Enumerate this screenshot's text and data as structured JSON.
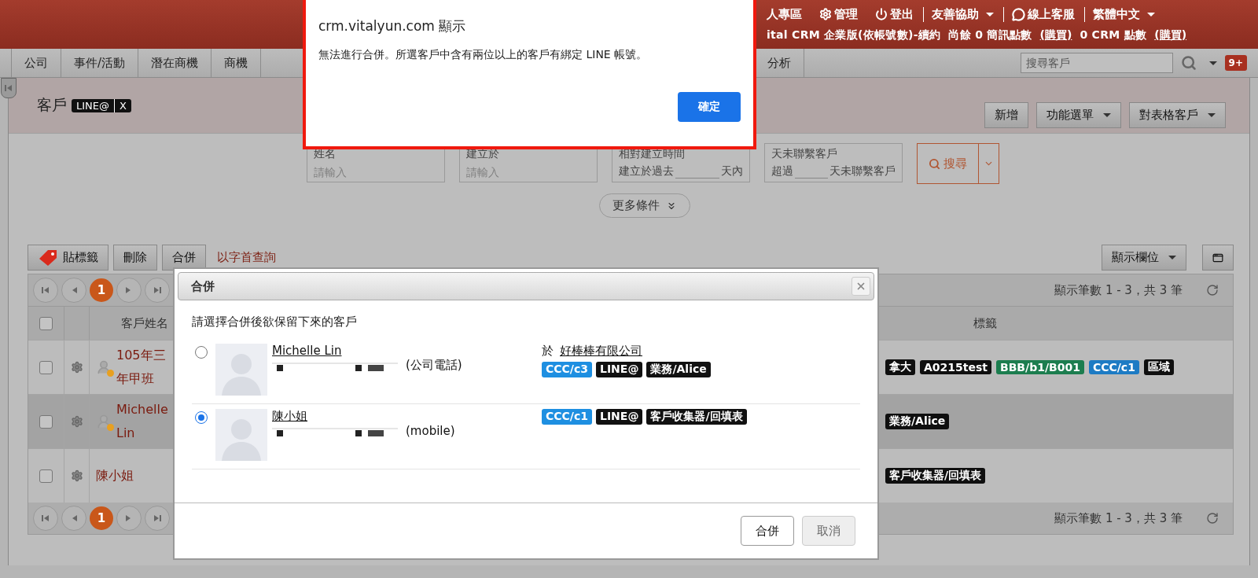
{
  "header": {
    "account_links": [
      {
        "kind": "person",
        "label": "人專區"
      },
      {
        "kind": "gear",
        "label": "管理"
      },
      {
        "kind": "power",
        "label": "登出"
      },
      {
        "kind": "dropdown",
        "label": "友善協助"
      },
      {
        "kind": "chat",
        "label": "線上客服"
      },
      {
        "kind": "dropdown",
        "label": "繁體中文"
      }
    ],
    "info_line": [
      {
        "kind": "text",
        "text": "ital CRM 企業版(依帳號數)-續約"
      },
      {
        "kind": "text",
        "text": "尚餘 0 簡訊點數"
      },
      {
        "kind": "link",
        "text": "(購買)"
      },
      {
        "kind": "text",
        "text": "0 CRM 點數"
      },
      {
        "kind": "link",
        "text": "(購買)"
      }
    ]
  },
  "nav": {
    "tabs": [
      {
        "label": "公司"
      },
      {
        "label": "事件/活動"
      },
      {
        "label": "潛在商機"
      },
      {
        "label": "商機"
      }
    ],
    "partial_tab": "分析",
    "search": {
      "placeholder": "搜尋客戶"
    },
    "badge": "9+"
  },
  "page": {
    "title": "客戶",
    "filter_tag": {
      "label": "LINE@",
      "remove": "X"
    },
    "actions": [
      {
        "label": "新增",
        "dropdown": false
      },
      {
        "label": "功能選單",
        "dropdown": true
      },
      {
        "label": "對表格客戶",
        "dropdown": true
      }
    ],
    "filters": [
      {
        "kind": "input",
        "label": "姓名",
        "placeholder": "請輸入"
      },
      {
        "kind": "input",
        "label": "建立於",
        "placeholder": "請輸入"
      },
      {
        "kind": "range",
        "label": "相對建立時間",
        "prefix": "建立於過去",
        "suffix": "天內"
      },
      {
        "kind": "range",
        "label": "天未聯繫客戶",
        "prefix": "超過",
        "suffix": "天未聯繫客戶"
      }
    ],
    "search_button": "搜尋",
    "more_conditions": "更多條件",
    "toolbar": {
      "buttons": [
        {
          "kind": "tag",
          "label": "貼標籤"
        },
        {
          "kind": "plain",
          "label": "刪除"
        },
        {
          "kind": "plain",
          "label": "合併"
        }
      ],
      "initial_search_link": "以字首查詢",
      "columns_button": "顯示欄位"
    }
  },
  "table": {
    "all_checked": false,
    "pagers": [
      {
        "page": "1",
        "summary": "顯示筆數 1 - 3，共 3 筆"
      },
      {
        "page": "1",
        "summary": "顯示筆數 1 - 3，共 3 筆"
      }
    ],
    "columns": [
      {
        "label": "客戶姓名"
      },
      {
        "label": "標籤"
      }
    ],
    "rows": [
      {
        "name": "105年三年甲班",
        "linked": true,
        "selected": false,
        "checked": false,
        "tags": [
          {
            "label": "拿大",
            "color": "#0f0f0f"
          },
          {
            "label": "A0215test",
            "color": "#0f0f0f"
          },
          {
            "label": "BBB/b1/B001",
            "color": "#1c7d4f"
          },
          {
            "label": "CCC/c1",
            "color": "#1d7bc4"
          },
          {
            "label": "區域",
            "color": "#0f0f0f"
          }
        ]
      },
      {
        "name": "Michelle Lin",
        "linked": true,
        "selected": true,
        "checked": false,
        "tags": [
          {
            "label": "業務/Alice",
            "color": "#0f0f0f"
          }
        ]
      },
      {
        "name": "陳小姐",
        "linked": false,
        "selected": false,
        "checked": false,
        "tags": [
          {
            "label": "客戶收集器/回填表",
            "color": "#0f0f0f"
          }
        ]
      }
    ]
  },
  "merge_dialog": {
    "title": "合併",
    "prompt": "請選擇合併後欲保留下來的客戶",
    "options": [
      {
        "name": "Michelle Lin",
        "phone_type": "(公司電話)",
        "selected": false,
        "company_prefix": "於",
        "company": "好棒棒有限公司",
        "tags": [
          {
            "label": "CCC/c3",
            "color": "#1e8fe1"
          },
          {
            "label": "LINE@",
            "color": "#111111"
          },
          {
            "label": "業務/Alice",
            "color": "#111111"
          }
        ]
      },
      {
        "name": "陳小姐",
        "phone_type": "(mobile)",
        "selected": true,
        "tags": [
          {
            "label": "CCC/c1",
            "color": "#1e8fe1"
          },
          {
            "label": "LINE@",
            "color": "#111111"
          },
          {
            "label": "客戶收集器/回填表",
            "color": "#111111"
          }
        ]
      }
    ],
    "buttons": [
      {
        "label": "合併",
        "disabled": false
      },
      {
        "label": "取消",
        "disabled": true
      }
    ]
  },
  "alert": {
    "title": "crm.vitalyun.com 顯示",
    "message": "無法進行合併。所選客戶中含有兩位以上的客戶有綁定 LINE 帳號。",
    "button": "確定"
  }
}
